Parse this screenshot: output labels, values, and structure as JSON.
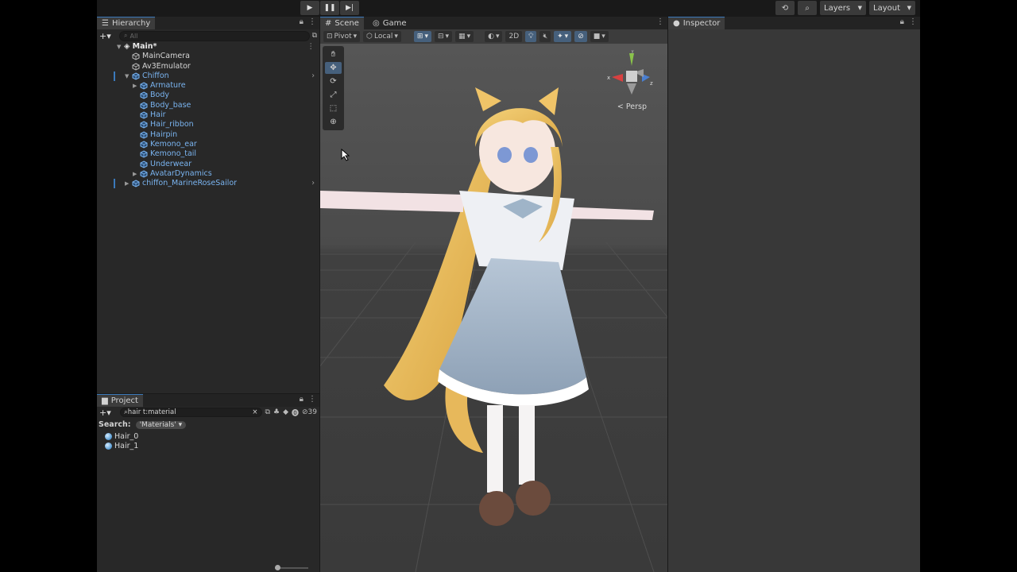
{
  "toolbar": {
    "play_icon": "play-icon",
    "pause_icon": "pause-icon",
    "step_icon": "step-icon",
    "layers_label": "Layers",
    "layout_label": "Layout"
  },
  "hierarchy": {
    "tab_label": "Hierarchy",
    "search_placeholder": "All",
    "scene_name": "Main*",
    "items": [
      {
        "label": "MainCamera",
        "depth": 1,
        "color": "white"
      },
      {
        "label": "Av3Emulator",
        "depth": 1,
        "color": "white"
      },
      {
        "label": "Chiffon",
        "depth": 1,
        "color": "blue",
        "expanded": true,
        "selected_marker": true
      },
      {
        "label": "Armature",
        "depth": 2,
        "color": "blue",
        "collapsed": true
      },
      {
        "label": "Body",
        "depth": 2,
        "color": "blue"
      },
      {
        "label": "Body_base",
        "depth": 2,
        "color": "blue"
      },
      {
        "label": "Hair",
        "depth": 2,
        "color": "blue"
      },
      {
        "label": "Hair_ribbon",
        "depth": 2,
        "color": "blue"
      },
      {
        "label": "Hairpin",
        "depth": 2,
        "color": "blue"
      },
      {
        "label": "Kemono_ear",
        "depth": 2,
        "color": "blue"
      },
      {
        "label": "Kemono_tail",
        "depth": 2,
        "color": "blue"
      },
      {
        "label": "Underwear",
        "depth": 2,
        "color": "blue"
      },
      {
        "label": "AvatarDynamics",
        "depth": 2,
        "color": "blue",
        "collapsed": true
      },
      {
        "label": "chiffon_MarineRoseSailor",
        "depth": 1,
        "color": "blue",
        "collapsed": true,
        "selected_marker": true
      }
    ]
  },
  "project": {
    "tab_label": "Project",
    "search_value": "hair t:material",
    "hidden_count": "39",
    "search_label": "Search:",
    "search_scope": "'Materials'",
    "assets": [
      "Hair_0",
      "Hair_1"
    ]
  },
  "scene": {
    "tab_scene": "Scene",
    "tab_game": "Game",
    "pivot_label": "Pivot",
    "local_label": "Local",
    "mode_2d": "2D",
    "persp_label": "Persp"
  },
  "inspector": {
    "tab_label": "Inspector"
  },
  "colors": {
    "accent": "#3a79bb",
    "prefab_blue": "#7ab4f0",
    "panel_bg": "#282828",
    "inspector_bg": "#383838"
  }
}
